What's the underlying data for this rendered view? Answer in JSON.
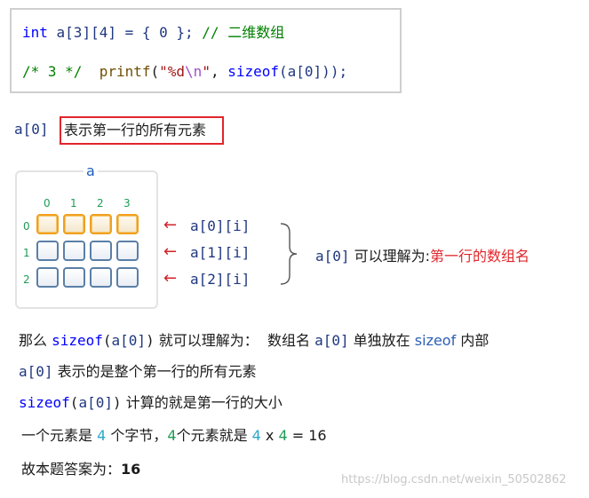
{
  "code": {
    "line1": {
      "kw": "int",
      "decl": " a[3][4] = { 0 }; ",
      "comment": "// 二维数组"
    },
    "line2": {
      "comment": "/* 3 */",
      "gap": "  ",
      "fn": "printf",
      "p1": "(",
      "str1": "\"%d",
      "esc": "\\n",
      "str2": "\"",
      "comma": ", ",
      "kw": "sizeof",
      "rest": "(a[0]));"
    }
  },
  "note1": {
    "subject": "a[0]",
    "boxed": "表示第一行的所有元素"
  },
  "diagram": {
    "title": "a",
    "col_indices": [
      "0",
      "1",
      "2",
      "3"
    ],
    "row_indices": [
      "0",
      "1",
      "2"
    ],
    "row_labels": [
      "a[0][i]",
      "a[1][i]",
      "a[2][i]"
    ],
    "arrow": "←",
    "brace": "}",
    "summary_subject": "a[0]",
    "summary_text": " 可以理解为:",
    "summary_red": "第一行的数组名"
  },
  "lines": {
    "l1": {
      "a": "那么 ",
      "kw": "sizeof",
      "b": "(",
      "c": "a[0]",
      "d": ")",
      "e": " 就可以理解为：  数组名 ",
      "f": "a[0]",
      "g": " 单独放在 ",
      "h": "sizeof",
      "i": " 内部"
    },
    "l2": {
      "a": "a[0]",
      "b": " 表示的是整个第一行的所有元素"
    },
    "l3": {
      "kw": "sizeof",
      "a": "(",
      "b": "a[0]",
      "c": ")",
      "d": " 计算的就是第一行的大小"
    },
    "l4": {
      "a": "一个元素是 ",
      "n1": "4",
      "b": " 个字节，",
      "n2": "4",
      "c": "个元素就是 ",
      "n3": "4",
      "d": " x ",
      "n4": "4",
      "e": " = 16"
    },
    "l5": {
      "a": "故本题答案为：",
      "b": "16"
    }
  },
  "watermark": "https://blog.csdn.net/weixin_50502862"
}
